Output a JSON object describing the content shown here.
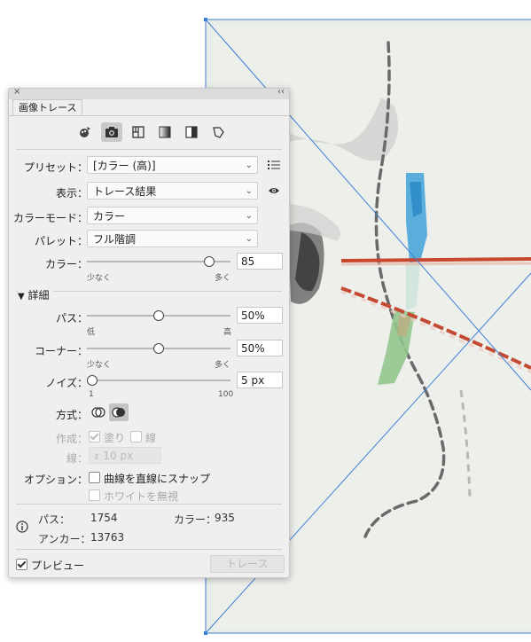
{
  "panel": {
    "tab_label": "画像トレース",
    "close_glyph": "×",
    "collapse_glyph": "‹‹",
    "preset": {
      "label": "プリセット：",
      "value": "[カラー (高)]"
    },
    "view": {
      "label": "表示：",
      "value": "トレース結果"
    },
    "color_mode": {
      "label": "カラーモード：",
      "value": "カラー"
    },
    "palette": {
      "label": "パレット：",
      "value": "フル階調"
    },
    "colors": {
      "label": "カラー：",
      "value": "85",
      "level": 0.85,
      "min_label": "少なく",
      "max_label": "多く"
    },
    "advanced_label": "詳細",
    "paths": {
      "label": "パス：",
      "value": "50%",
      "level": 0.5,
      "min_label": "低",
      "max_label": "高"
    },
    "corners": {
      "label": "コーナー：",
      "value": "50%",
      "level": 0.5,
      "min_label": "少なく",
      "max_label": "多く"
    },
    "noise": {
      "label": "ノイズ：",
      "value": "5 px",
      "level": 0.04,
      "min_label": "1",
      "max_label": "100"
    },
    "method": {
      "label": "方式："
    },
    "create": {
      "label": "作成：",
      "fill_label": "塗り",
      "stroke_label": "線"
    },
    "stroke": {
      "label": "線：",
      "value": "10 px"
    },
    "options": {
      "label": "オプション：",
      "snap_label": "曲線を直線にスナップ",
      "ignore_white_label": "ホワイトを無視"
    },
    "stats": {
      "paths_label": "パス：",
      "paths_value": "1754",
      "colors_label": "カラー：",
      "colors_value": "935",
      "anchors_label": "アンカー：",
      "anchors_value": "13763"
    },
    "preview_label": "プレビュー",
    "trace_button_label": "トレース"
  },
  "colors": {
    "artboard_bg": "#e9ece8",
    "selection_line": "#3b7fd6",
    "red_line": "#d24a3a",
    "blue_stroke": "#3a9fd8",
    "green_stroke": "#8ec58a"
  }
}
